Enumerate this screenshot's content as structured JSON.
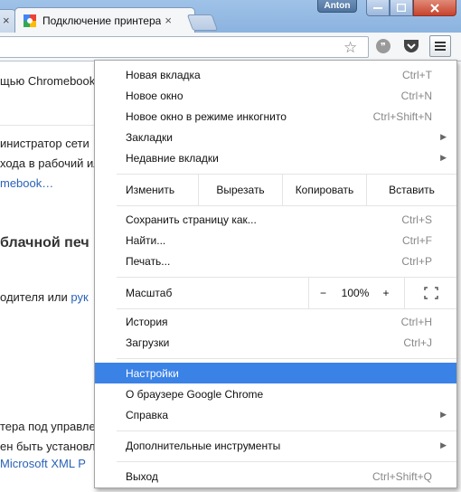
{
  "window": {
    "user_name": "Anton",
    "tab_title": "Подключение принтера",
    "close_symbol": "×"
  },
  "page": {
    "lines": [
      "щью Chromebook",
      "инистратор сети",
      "хода в рабочий ил",
      "mebook…",
      "блачной печ",
      "одителя или",
      "рук",
      "тера под управле",
      "ен быть установл",
      "Microsoft XML P"
    ]
  },
  "menu": {
    "group1": [
      {
        "label": "Новая вкладка",
        "shortcut": "Ctrl+T"
      },
      {
        "label": "Новое окно",
        "shortcut": "Ctrl+N"
      },
      {
        "label": "Новое окно в режиме инкогнито",
        "shortcut": "Ctrl+Shift+N"
      },
      {
        "label": "Закладки",
        "shortcut": ""
      },
      {
        "label": "Недавние вкладки",
        "shortcut": ""
      }
    ],
    "edit": {
      "label": "Изменить",
      "cut": "Вырезать",
      "copy": "Копировать",
      "paste": "Вставить"
    },
    "group2": [
      {
        "label": "Сохранить страницу как...",
        "shortcut": "Ctrl+S"
      },
      {
        "label": "Найти...",
        "shortcut": "Ctrl+F"
      },
      {
        "label": "Печать...",
        "shortcut": "Ctrl+P"
      }
    ],
    "zoom": {
      "label": "Масштаб",
      "minus": "−",
      "value": "100%",
      "plus": "+"
    },
    "group3": [
      {
        "label": "История",
        "shortcut": "Ctrl+H"
      },
      {
        "label": "Загрузки",
        "shortcut": "Ctrl+J"
      }
    ],
    "group4": [
      {
        "label": "Настройки"
      },
      {
        "label": "О браузере Google Chrome"
      },
      {
        "label": "Справка"
      }
    ],
    "more_tools": "Дополнительные инструменты",
    "exit": {
      "label": "Выход",
      "shortcut": "Ctrl+Shift+Q"
    }
  },
  "colors": {
    "highlight": "#3b82e6",
    "link": "#2a62b8"
  }
}
